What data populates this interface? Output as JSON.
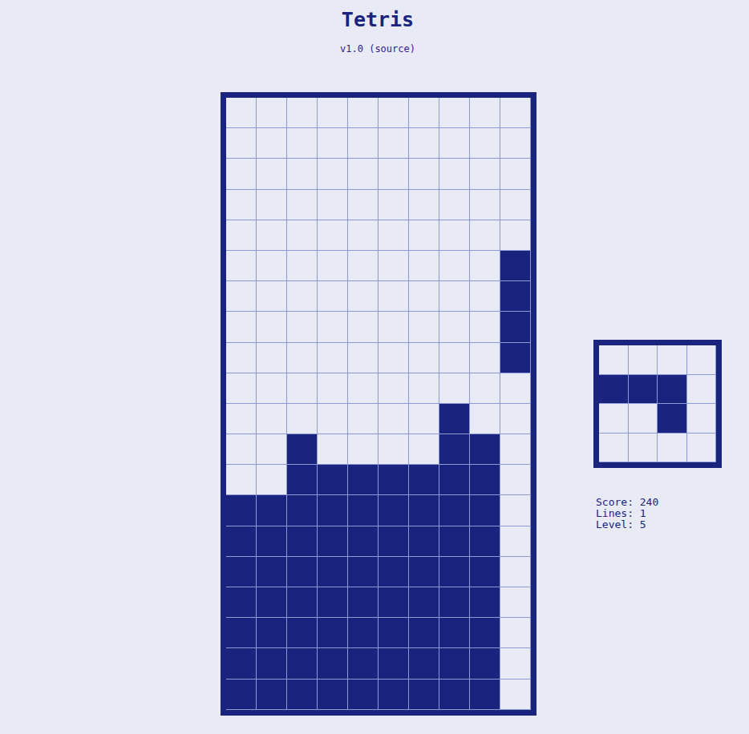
{
  "window": {
    "title": "Tetris",
    "subtitle": "v1.0 (source)"
  },
  "board": {
    "rows": [
      [
        false,
        false,
        false,
        false,
        false,
        false,
        false,
        false,
        false,
        false
      ],
      [
        false,
        false,
        false,
        false,
        false,
        false,
        false,
        false,
        false,
        false
      ],
      [
        false,
        false,
        false,
        false,
        false,
        false,
        false,
        false,
        false,
        false
      ],
      [
        false,
        false,
        false,
        false,
        false,
        false,
        false,
        false,
        false,
        false
      ],
      [
        false,
        false,
        false,
        false,
        false,
        false,
        false,
        false,
        false,
        false
      ],
      [
        false,
        false,
        false,
        false,
        false,
        false,
        false,
        false,
        false,
        true
      ],
      [
        false,
        false,
        false,
        false,
        false,
        false,
        false,
        false,
        false,
        true
      ],
      [
        false,
        false,
        false,
        false,
        false,
        false,
        false,
        false,
        false,
        true
      ],
      [
        false,
        false,
        false,
        false,
        false,
        false,
        false,
        false,
        false,
        true
      ],
      [
        false,
        false,
        false,
        false,
        false,
        false,
        false,
        false,
        false,
        false
      ],
      [
        false,
        false,
        false,
        false,
        false,
        false,
        false,
        true,
        false,
        false
      ],
      [
        false,
        false,
        true,
        false,
        false,
        false,
        false,
        true,
        true,
        false
      ],
      [
        false,
        false,
        true,
        true,
        true,
        true,
        true,
        true,
        true,
        false
      ],
      [
        true,
        true,
        true,
        true,
        true,
        true,
        true,
        true,
        true,
        false
      ],
      [
        true,
        true,
        true,
        true,
        true,
        true,
        true,
        true,
        true,
        false
      ],
      [
        true,
        true,
        true,
        true,
        true,
        true,
        true,
        true,
        true,
        false
      ],
      [
        true,
        true,
        true,
        true,
        true,
        true,
        true,
        true,
        true,
        false
      ],
      [
        true,
        true,
        true,
        true,
        true,
        true,
        true,
        true,
        true,
        false
      ],
      [
        true,
        true,
        true,
        true,
        true,
        true,
        true,
        true,
        true,
        false
      ],
      [
        true,
        true,
        true,
        true,
        true,
        true,
        true,
        true,
        true,
        false
      ]
    ]
  },
  "next_piece": {
    "rows": [
      [
        false,
        false,
        false,
        false
      ],
      [
        true,
        true,
        true,
        false
      ],
      [
        false,
        false,
        true,
        false
      ],
      [
        false,
        false,
        false,
        false
      ]
    ]
  },
  "stats": [
    {
      "text": "Score: 240"
    },
    {
      "text": "Lines: 1"
    },
    {
      "text": "Level: 5"
    }
  ]
}
